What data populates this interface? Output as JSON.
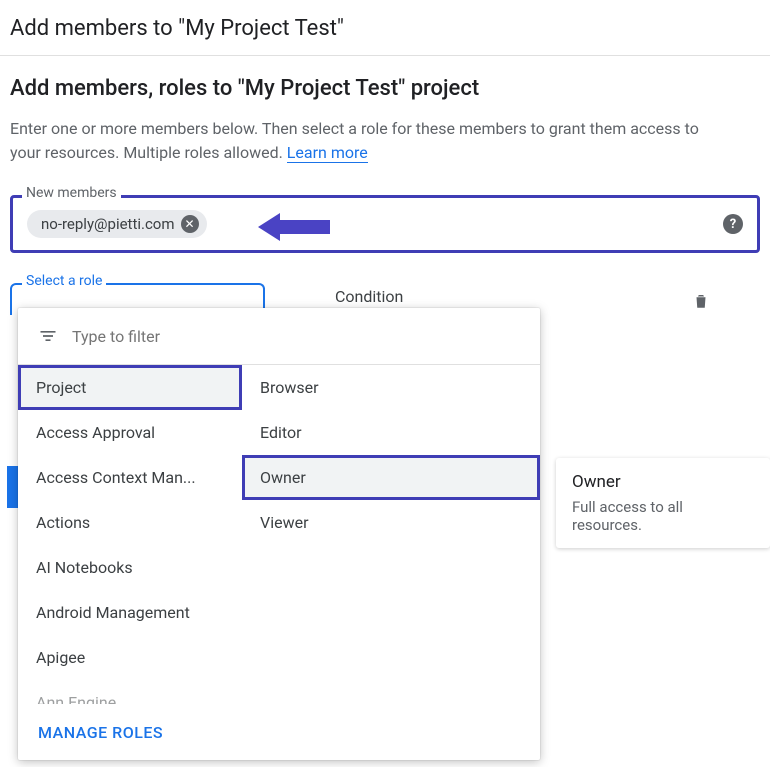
{
  "dialog": {
    "title": "Add members to \"My Project Test\""
  },
  "section": {
    "heading": "Add members, roles to \"My Project Test\" project",
    "description_pre": "Enter one or more members below. Then select a role for these members to grant them access to your resources. Multiple roles allowed. ",
    "learn_more": "Learn more"
  },
  "members": {
    "label": "New members",
    "chips": [
      {
        "email": "no-reply@pietti.com"
      }
    ]
  },
  "role": {
    "select_label": "Select a role",
    "condition_label": "Condition"
  },
  "dropdown": {
    "filter_placeholder": "Type to filter",
    "categories": [
      "Project",
      "Access Approval",
      "Access Context Man...",
      "Actions",
      "AI Notebooks",
      "Android Management",
      "Apigee",
      "Ann Engine"
    ],
    "selected_category_index": 0,
    "roles": [
      "Browser",
      "Editor",
      "Owner",
      "Viewer"
    ],
    "selected_role_index": 2,
    "manage_roles": "MANAGE ROLES"
  },
  "tooltip": {
    "title": "Owner",
    "body": "Full access to all resources."
  }
}
